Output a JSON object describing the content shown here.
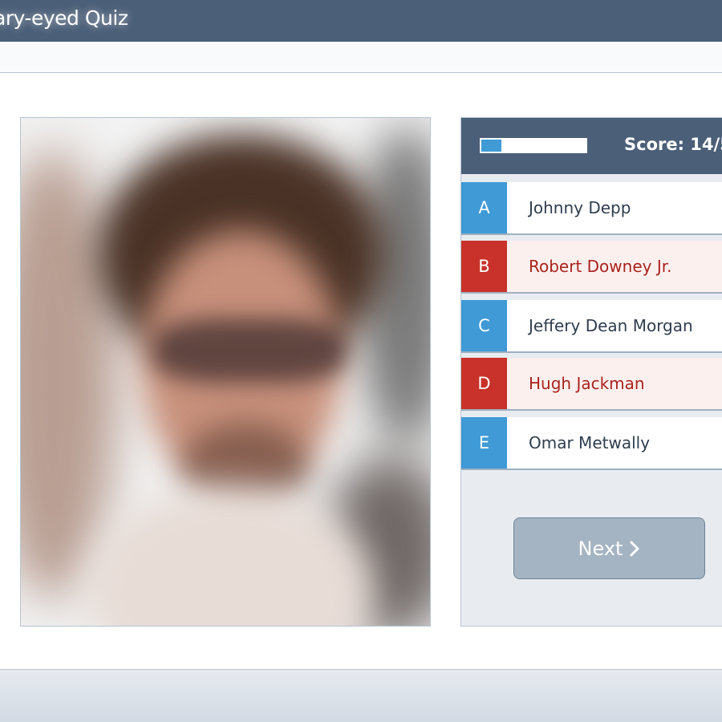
{
  "header": {
    "title": "ary-eyed Quiz"
  },
  "quiz": {
    "progress": 0.19,
    "score_text": "Score: 14/5",
    "options": [
      {
        "letter": "A",
        "label": "Johnny Depp",
        "state": "default"
      },
      {
        "letter": "B",
        "label": "Robert Downey Jr.",
        "state": "wrong"
      },
      {
        "letter": "C",
        "label": "Jeffery Dean Morgan",
        "state": "default"
      },
      {
        "letter": "D",
        "label": "Hugh Jackman",
        "state": "wrong"
      },
      {
        "letter": "E",
        "label": "Omar Metwally",
        "state": "default"
      }
    ],
    "next_label": "Next",
    "next_icon": "chevron-right-icon"
  },
  "colors": {
    "header_bg": "#4b5f78",
    "option_accent": "#3f9ad6",
    "wrong_accent": "#c8322a",
    "wrong_text": "#a8231c",
    "button_bg": "#a5b4c3"
  }
}
